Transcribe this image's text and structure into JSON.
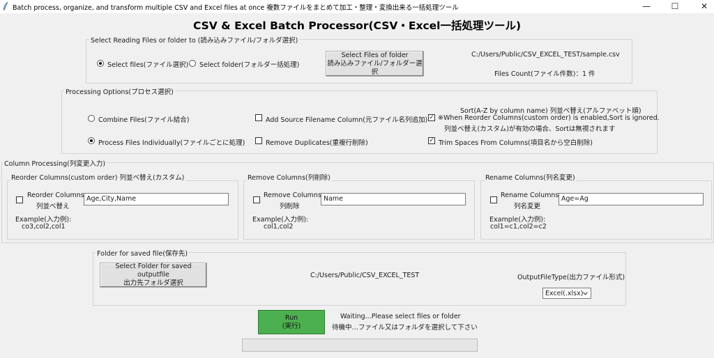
{
  "window": {
    "title": "Batch process, organize, and transform multiple CSV and Excel files at once 複数ファイルをまとめて加工・整理・変換出来る一括処理ツール",
    "minimize": "—",
    "maximize": "☐",
    "close": "✕"
  },
  "heading": "CSV & Excel Batch Processor(CSV・Excel一括処理ツール)",
  "reading": {
    "legend": "Select Reading Files or folder to (読み込みファイル/フォルダ選択)",
    "option_files": "Select files(ファイル選択)",
    "option_folder": "Select folder(フォルダー括処理)",
    "select_button_line1": "Select Files of folder",
    "select_button_line2": "読み込みファイル/フォルダー選択",
    "path": "C:/Users/Public/CSV_EXCEL_TEST/sample.csv",
    "files_count": "Files Count(ファイル件数)：1 件",
    "selected": "files"
  },
  "processing": {
    "legend": "Processing Options(プロセス選択)",
    "combine": "Combine Files(ファイル結合)",
    "individual": "Process Files Individually(ファイルごとに処理)",
    "add_source": "Add Source Filename Column(元ファイル名列追加)",
    "remove_duplicates": "Remove Duplicates(重複行削除)",
    "sort_line1": "Sort(A-Z by column name) 列並べ替え(アルファベット順)",
    "sort_line2": "※When Reorder Columns(custom order) is enabled,Sort is ignored.",
    "sort_line3": "列並べ替え(カスタム)が有効の場合、Sortは無視されます",
    "trim": "Trim Spaces From Columns(項目名から空白削除)",
    "checked_mark": "✓"
  },
  "columns": {
    "legend": "Column Processing(列変更入力)",
    "reorder": {
      "legend": "Reorder Columns(custom order) 列並べ替え(カスタム)",
      "check_line1": "Reorder Columns",
      "check_line2": "列並べ替え",
      "value": "Age,City,Name",
      "example_label": "Example(入力例):",
      "example_value": "co3,col2,col1"
    },
    "remove": {
      "legend": "Remove Columns(列削除)",
      "check_line1": "Remove Columns",
      "check_line2": "列削除",
      "value": "Name",
      "example_label": "Example(入力例):",
      "example_value": "col1,col2"
    },
    "rename": {
      "legend": "Rename Columns(列名変更)",
      "check_line1": "Rename Columns",
      "check_line2": "列名変更",
      "value": "Age=Ag",
      "example_label": "Example(入力例):",
      "example_value": "col1=c1,col2=c2"
    }
  },
  "output": {
    "legend": "Folder for saved file(保存先)",
    "button_line1": "Select Folder for saved outputfile",
    "button_line2": "出力先フォルダ選択",
    "path": "C:/Users/Public/CSV_EXCEL_TEST",
    "type_label": "OutputFileType(出力ファイル形式)",
    "type_value": "Excel(.xlsx)"
  },
  "run": {
    "label_line1": "Run",
    "label_line2": "(実行)",
    "status_line1": "Waiting...Please select files or folder",
    "status_line2": "待機中…ファイル又はフォルダを選択して下さい",
    "progress": 0
  }
}
